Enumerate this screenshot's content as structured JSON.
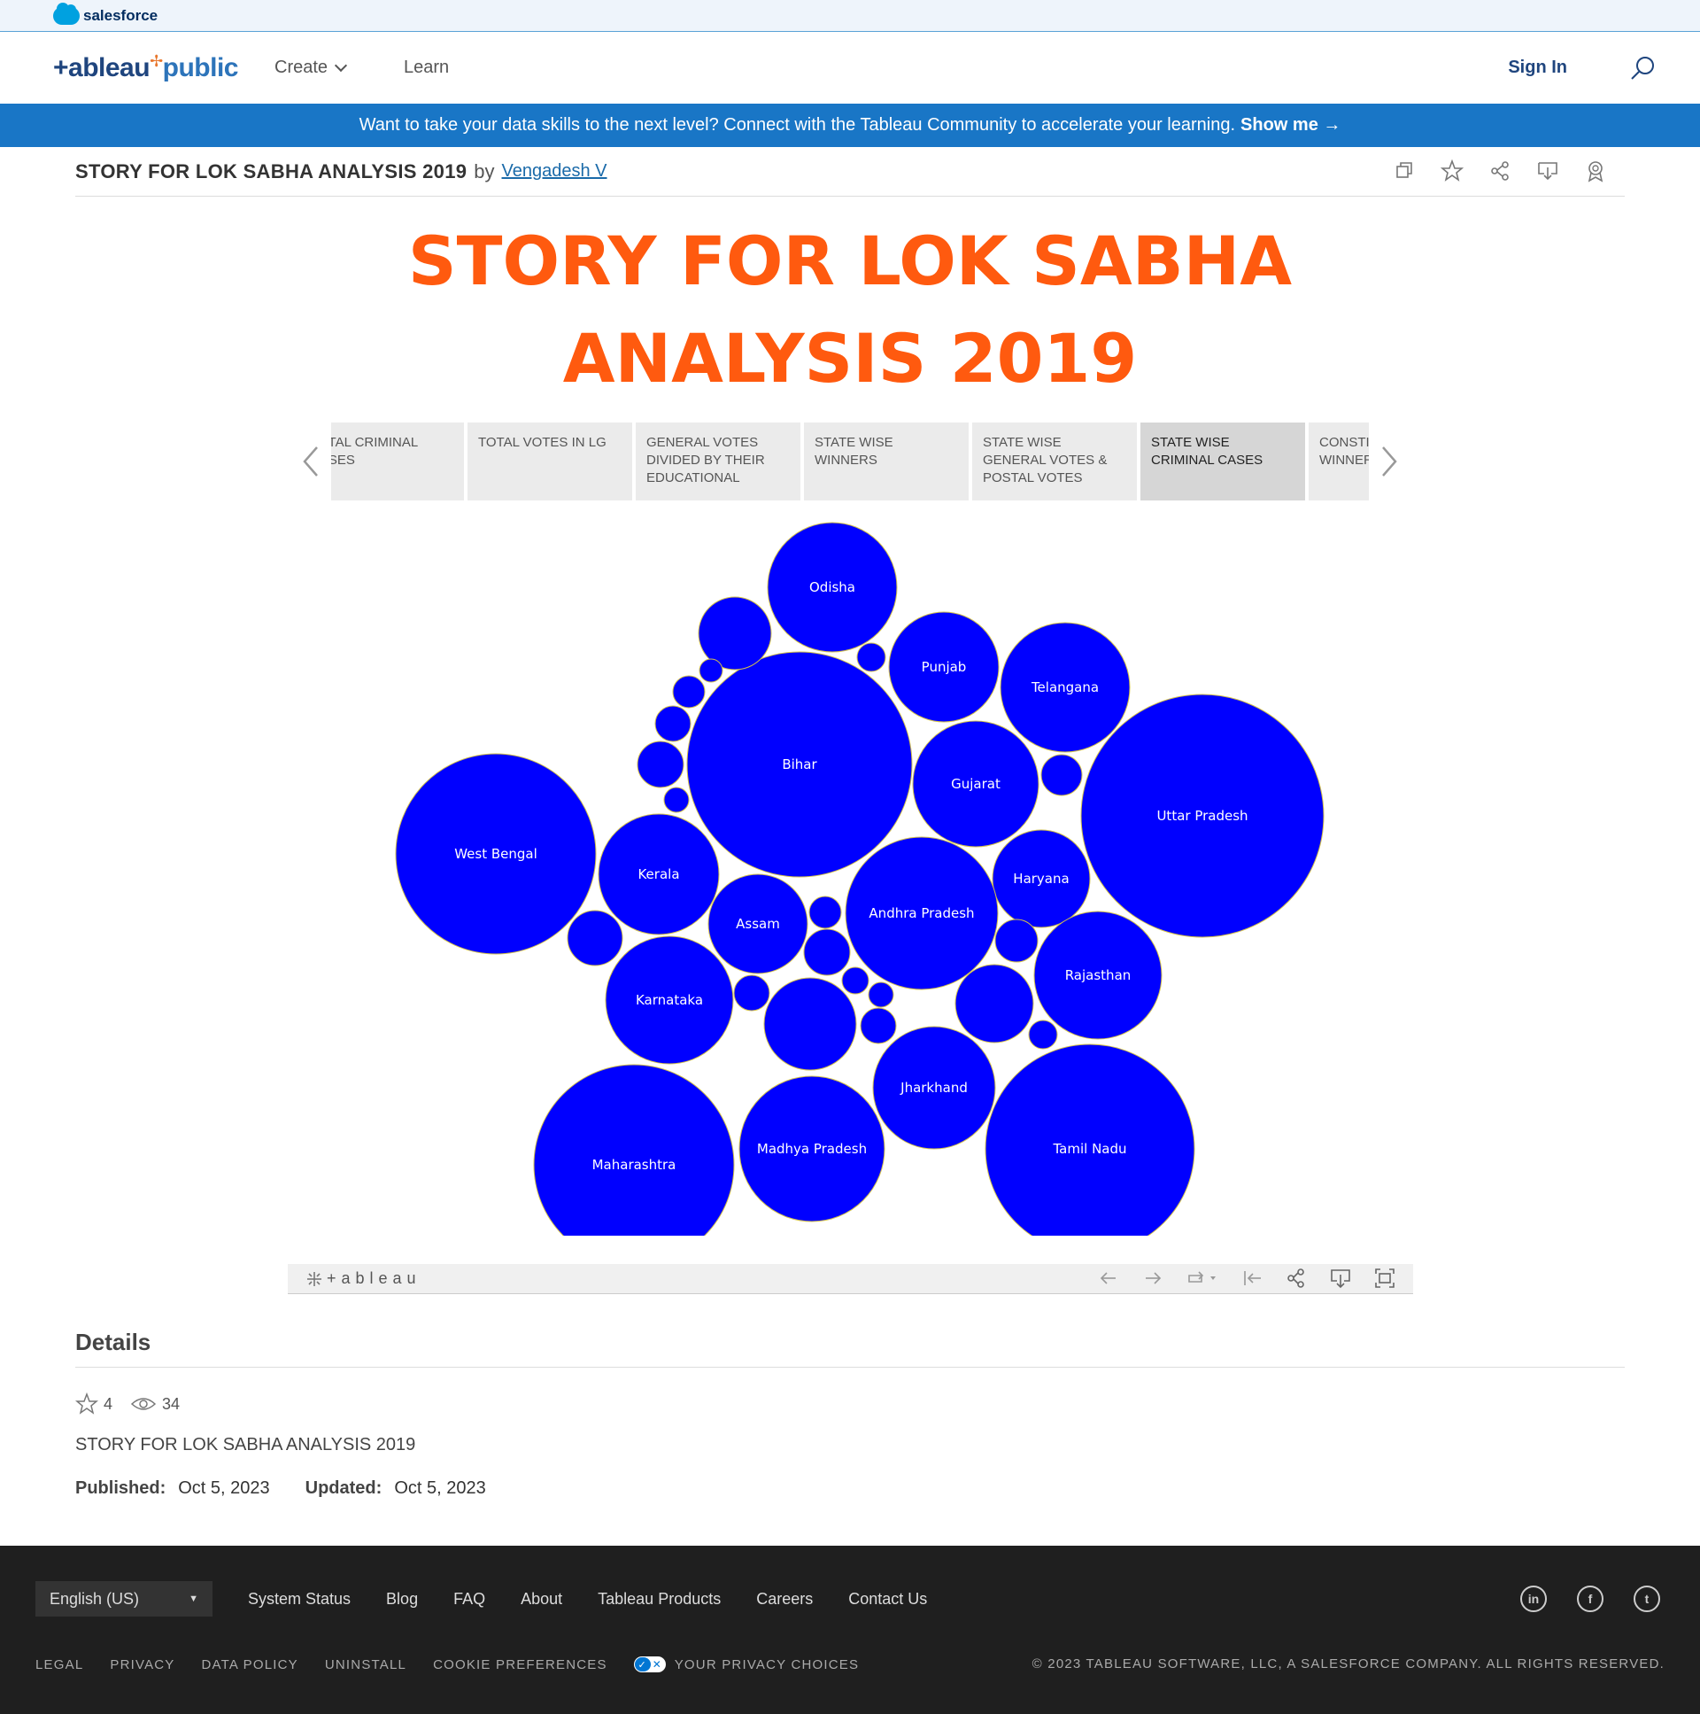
{
  "salesforce": {
    "logo_text": "salesforce"
  },
  "nav": {
    "logo_main": "+ableau",
    "logo_pub": "public",
    "create_label": "Create",
    "learn_label": "Learn",
    "signin_label": "Sign In"
  },
  "banner": {
    "text": "Want to take your data skills to the next level? Connect with the Tableau Community to accelerate your learning.",
    "cta": "Show me →"
  },
  "viz": {
    "title": "STORY FOR LOK SABHA ANALYSIS 2019",
    "by": "by",
    "author": "Vengadesh V"
  },
  "story": {
    "title_line1": "STORY FOR LOK SABHA",
    "title_line2": "ANALYSIS 2019",
    "tabs": [
      {
        "label": "TOTAL CRIMINAL CASES",
        "active": false
      },
      {
        "label": "TOTAL VOTES IN LG",
        "active": false
      },
      {
        "label": "GENERAL VOTES DIVIDED BY THEIR EDUCATIONAL",
        "active": false
      },
      {
        "label": "STATE WISE WINNERS",
        "active": false
      },
      {
        "label": "STATE WISE GENERAL VOTES & POSTAL VOTES",
        "active": false
      },
      {
        "label": "STATE WISE CRIMINAL CASES",
        "active": true
      },
      {
        "label": "CONSTITUENCY WINNERS",
        "active": false
      }
    ]
  },
  "chart_data": {
    "type": "bubble",
    "color": "#0000ff",
    "stroke": "#d4c24a",
    "labels": [
      "Odisha",
      "Punjab",
      "Telangana",
      "Bihar",
      "Gujarat",
      "Uttar Pradesh",
      "West Bengal",
      "Kerala",
      "Haryana",
      "Andhra Pradesh",
      "Assam",
      "Rajasthan",
      "Karnataka",
      "Jharkhand",
      "Madhya Pradesh",
      "Tamil Nadu",
      "Maharashtra"
    ]
  },
  "tableau_bar": {
    "logo": "+ableau"
  },
  "details": {
    "heading": "Details",
    "favorites": "4",
    "views": "34",
    "description": "STORY FOR LOK SABHA ANALYSIS 2019",
    "published_label": "Published:",
    "published_value": "Oct 5, 2023",
    "updated_label": "Updated:",
    "updated_value": "Oct 5, 2023"
  },
  "footer": {
    "language": "English (US)",
    "links": [
      "System Status",
      "Blog",
      "FAQ",
      "About",
      "Tableau Products",
      "Careers",
      "Contact Us"
    ],
    "legal": [
      "LEGAL",
      "PRIVACY",
      "DATA POLICY",
      "UNINSTALL",
      "COOKIE PREFERENCES"
    ],
    "privacy_choices": "YOUR PRIVACY CHOICES",
    "copyright": "© 2023 TABLEAU SOFTWARE, LLC, A SALESFORCE COMPANY. ALL RIGHTS RESERVED.",
    "social": [
      "in",
      "f",
      "t"
    ]
  }
}
